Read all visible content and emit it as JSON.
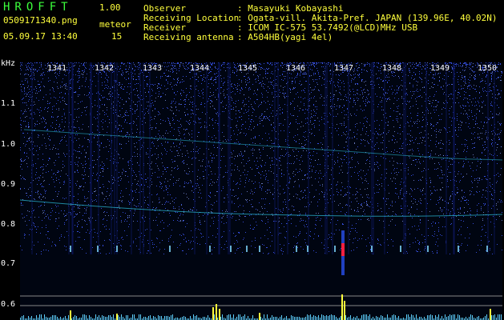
{
  "header": {
    "app_title": "HROFFT",
    "version": "1.00",
    "file_name": "0509171340.png",
    "meteor_label": "meteor",
    "timestamp": "05.09.17 13:40",
    "meteor_count": "15"
  },
  "info": [
    {
      "key": "Observer",
      "value": ": Masayuki Kobayashi"
    },
    {
      "key": "Receiving Location",
      "value": ": Ogata-vill. Akita-Pref. JAPAN (139.96E, 40.02N)"
    },
    {
      "key": "Receiver",
      "value": ": ICOM IC-575 53.7492(@LCD)MHz USB"
    },
    {
      "key": "Receiving antenna",
      "value": ": A504HB(yagi 4el)"
    }
  ],
  "axes": {
    "y_unit": "kHz",
    "y_ticks": [
      "1.1",
      "1.0",
      "0.9",
      "0.8",
      "0.7",
      "0.6"
    ],
    "x_ticks": [
      "1341",
      "1342",
      "1343",
      "1344",
      "1345",
      "1346",
      "1347",
      "1348",
      "1349",
      "1350"
    ]
  },
  "colors": {
    "background": "#000000",
    "label_yellow": "#ffff3c",
    "label_green": "#3cff3c",
    "noise_blue": "#3d5aff",
    "trace_cyan": "#34e0ff",
    "meteor_red": "#ff2040"
  }
}
